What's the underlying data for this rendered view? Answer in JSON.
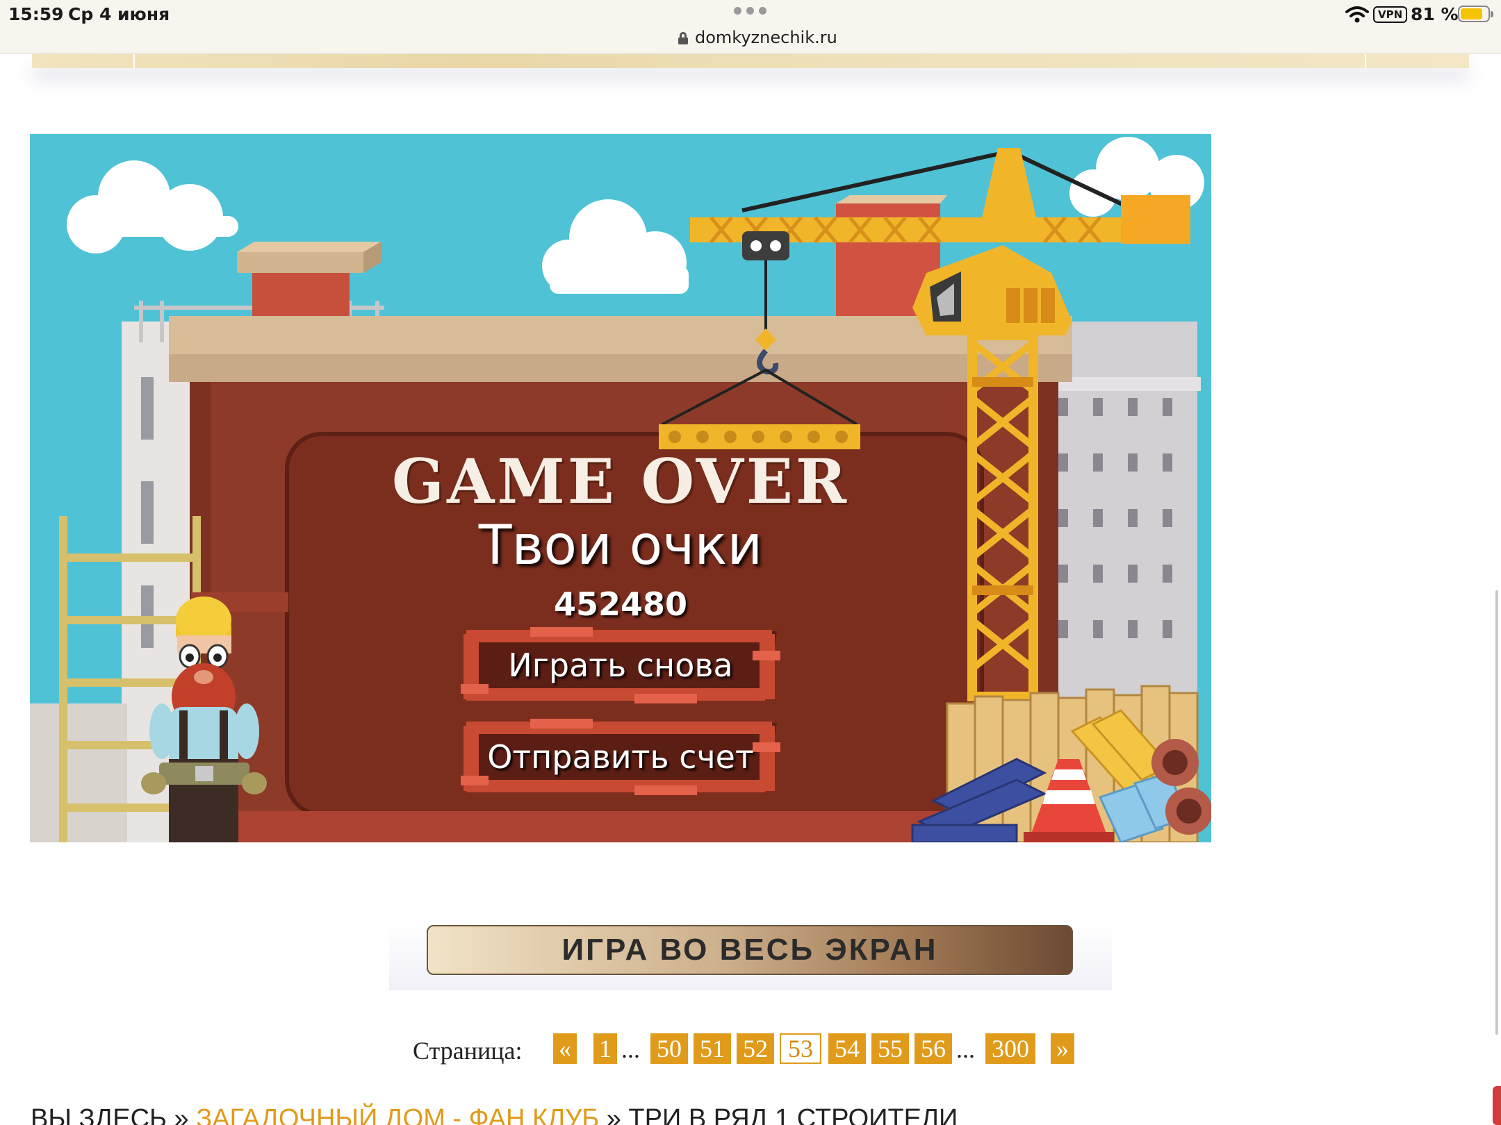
{
  "status_bar": {
    "time": "15:59",
    "date": "Ср 4 июня",
    "url": "domkyznechik.ru",
    "vpn": "VPN",
    "battery_percent": "81 %",
    "battery_level": 0.81
  },
  "game": {
    "title": "GAME OVER",
    "subtitle": "Твои очки",
    "score": "452480",
    "buttons": {
      "play_again": "Играть снова",
      "send_score": "Отправить счет"
    }
  },
  "fullscreen_button": "ИГРА ВО ВЕСЬ ЭКРАН",
  "pagination": {
    "label": "Страница:",
    "prev": "«",
    "next": "»",
    "ellipsis": "...",
    "pages": [
      "1",
      "50",
      "51",
      "52",
      "53",
      "54",
      "55",
      "56",
      "300"
    ],
    "current": "53"
  },
  "breadcrumb": {
    "prefix": "ВЫ ЗДЕСЬ »",
    "link": "ЗАГАДОЧНЫЙ ДОМ - ФАН КЛУБ",
    "current": "» ТРИ В РЯД 1 СТРОИТЕЛИ"
  },
  "colors": {
    "accent": "#e09b1a",
    "sky": "#4fc2d6",
    "board": "#7e2f20"
  }
}
